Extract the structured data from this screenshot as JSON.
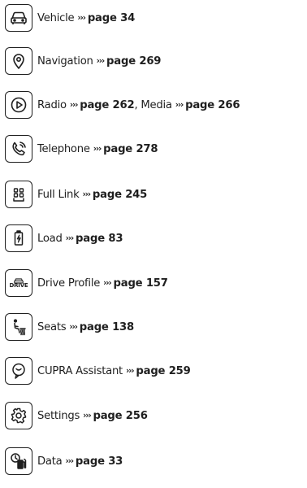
{
  "items": [
    {
      "icon": "car-front-icon",
      "label": "Vehicle",
      "arrows": "›››",
      "page_ref": "page 34"
    },
    {
      "icon": "location-pin-icon",
      "label": "Navigation",
      "arrows": "›››",
      "page_ref": "page 269"
    },
    {
      "icon": "play-icon",
      "label": "Radio",
      "arrows": "›››",
      "page_ref": "page 262",
      "label2": "Media",
      "page_ref2": "page 266"
    },
    {
      "icon": "telephone-icon",
      "label": "Telephone",
      "arrows": "›››",
      "page_ref": "page 278"
    },
    {
      "icon": "full-link-icon",
      "label": "Full Link",
      "arrows": "›››",
      "page_ref": "page 245"
    },
    {
      "icon": "battery-charge-icon",
      "label": "Load",
      "arrows": "›››",
      "page_ref": "page 83"
    },
    {
      "icon": "drive-profile-icon",
      "icon_text": "DRIVE",
      "label": "Drive Profile",
      "arrows": "›››",
      "page_ref": "page 157"
    },
    {
      "icon": "seat-heating-icon",
      "label": "Seats",
      "arrows": "›››",
      "page_ref": "page 138"
    },
    {
      "icon": "speech-assistant-icon",
      "label": "CUPRA Assistant",
      "arrows": "›››",
      "page_ref": "page 259"
    },
    {
      "icon": "settings-gear-icon",
      "label": "Settings",
      "arrows": "›››",
      "page_ref": "page 256"
    },
    {
      "icon": "data-fuel-icon",
      "label": "Data",
      "arrows": "›››",
      "page_ref": "page 33"
    }
  ]
}
